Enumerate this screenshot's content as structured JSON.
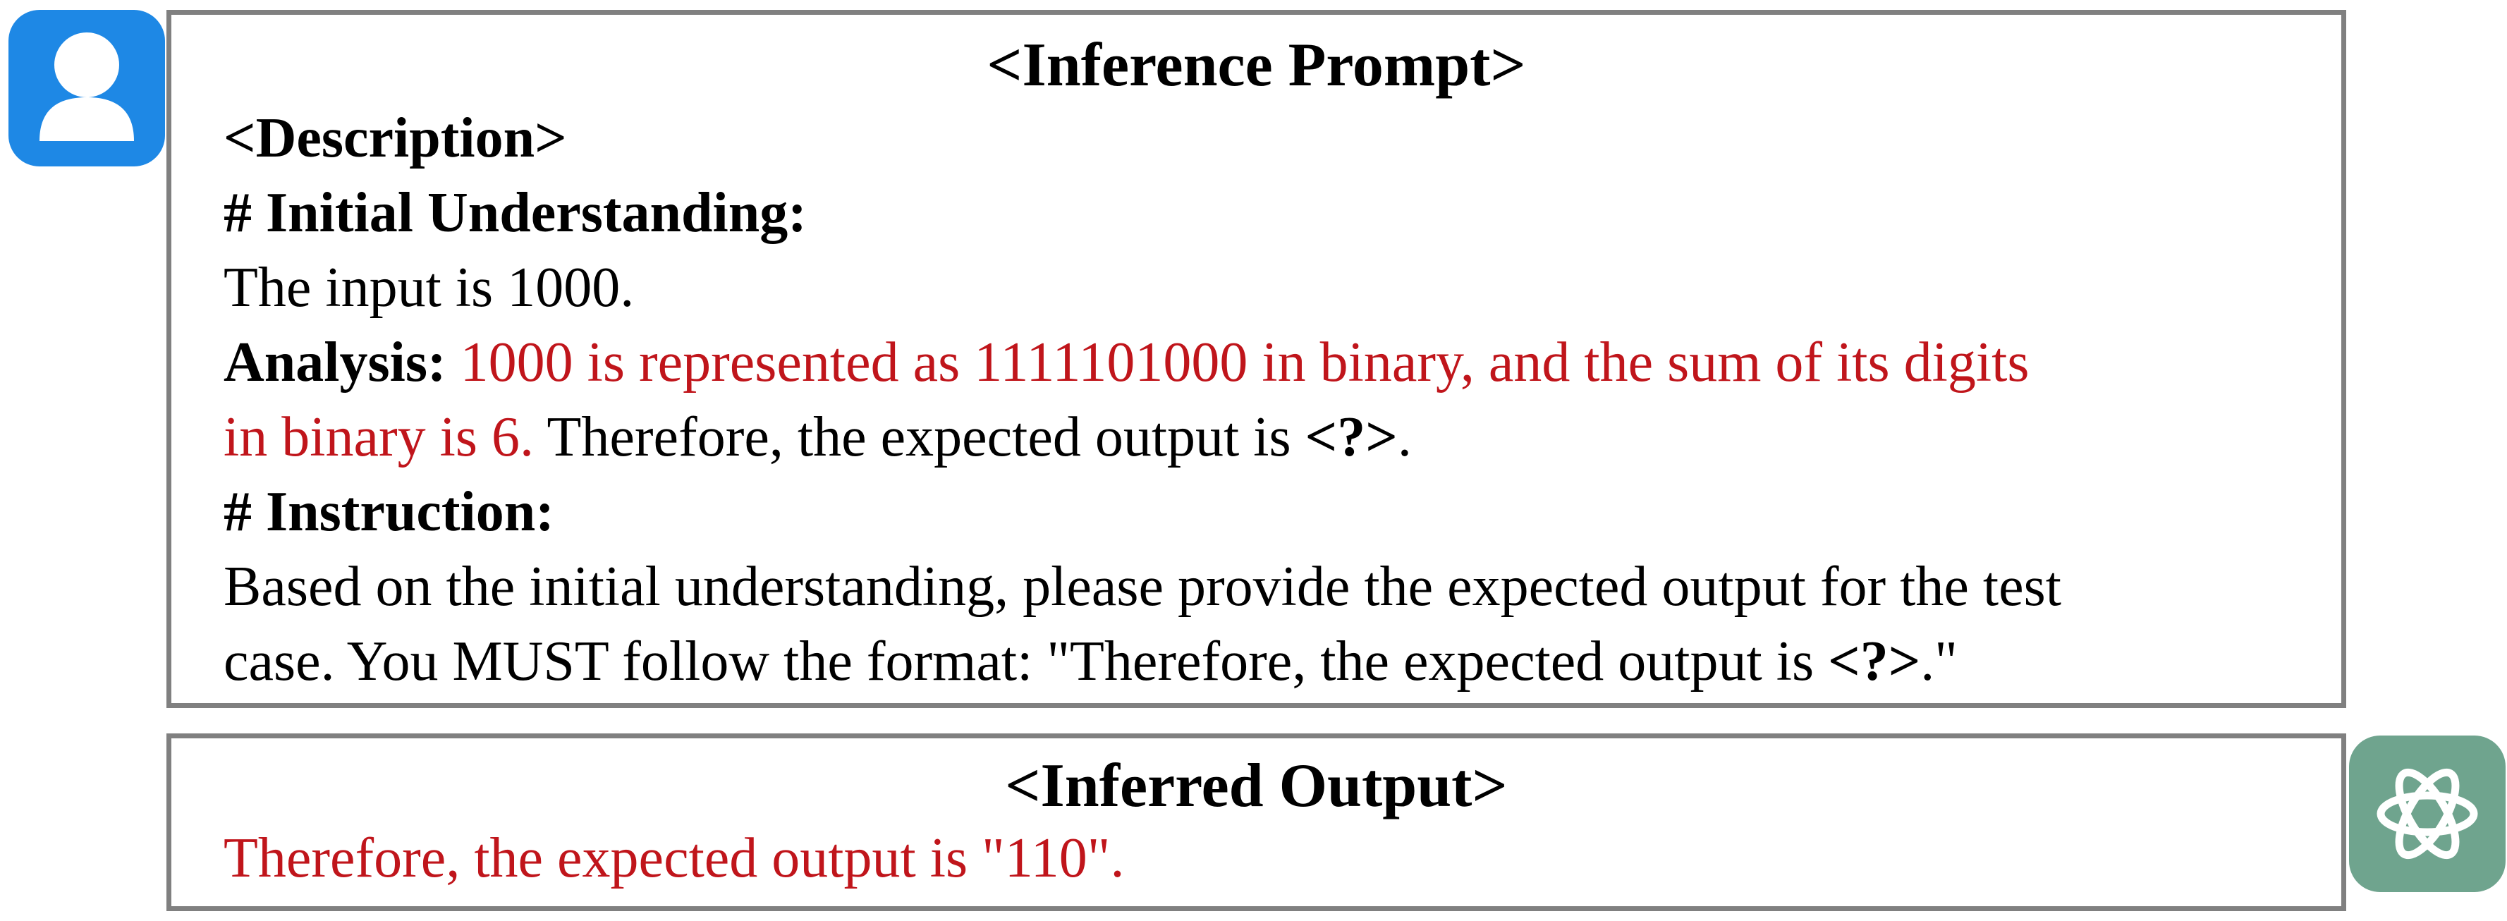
{
  "prompt": {
    "title": "<Inference Prompt>",
    "description_tag": "<Description>",
    "initial_heading": "# Initial Understanding:",
    "input_text": "The input is 1000.",
    "analysis_label": "Analysis:",
    "analysis_red_1": "1000 is represented as 1111101000 in binary, and the sum of its digits",
    "analysis_red_2": "in binary is 6.",
    "analysis_tail_text": " Therefore, the expected output is ",
    "analysis_placeholder": "<?>",
    "analysis_end": ".",
    "instruction_heading": "# Instruction:",
    "instruction_line_1": "Based on the initial understanding, please provide the expected output for the test",
    "instruction_line_2_a": "case. You MUST follow the format: \"Therefore, the expected output is ",
    "instruction_placeholder": "<?>",
    "instruction_line_2_b": ".\""
  },
  "output": {
    "title": "<Inferred Output>",
    "text": "Therefore, the expected output is \"110\"."
  },
  "colors": {
    "user_avatar": "#1e88e5",
    "bot_avatar": "#6fa48e",
    "highlight_red": "#c0151b",
    "border_gray": "#808080"
  },
  "icons": {
    "user": "user-icon",
    "assistant": "openai-logo-icon"
  }
}
